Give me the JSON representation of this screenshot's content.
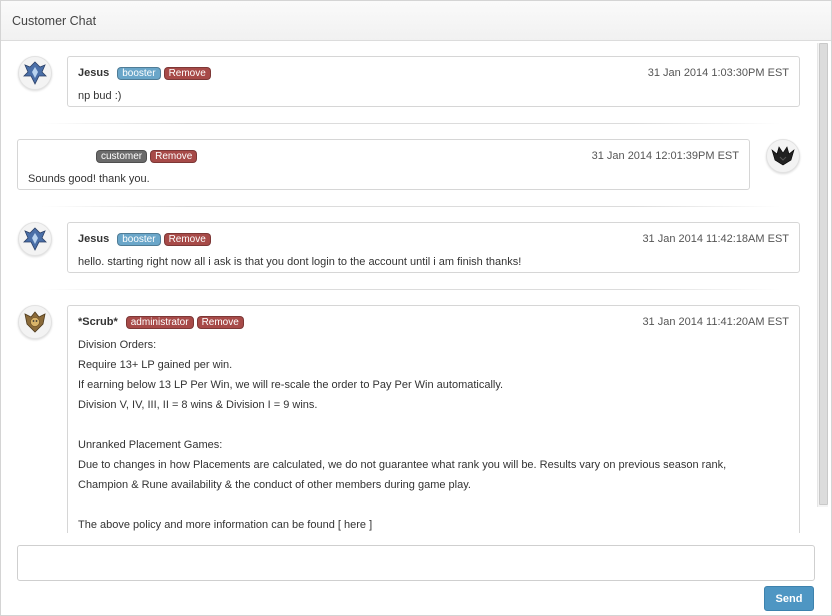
{
  "panel": {
    "title": "Customer Chat"
  },
  "messages": [
    {
      "name": "Jesus",
      "role": "booster",
      "remove_label": "Remove",
      "time": "31 Jan 2014 1:03:30PM EST",
      "text": "np bud :)",
      "avatar_icon": "diamond-rank-icon"
    },
    {
      "name": "",
      "role": "customer",
      "remove_label": "Remove",
      "time": "31 Jan 2014 12:01:39PM EST",
      "text": "Sounds good! thank you.",
      "avatar_icon": "dark-crest-icon"
    },
    {
      "name": "Jesus",
      "role": "booster",
      "remove_label": "Remove",
      "time": "31 Jan 2014 11:42:18AM EST",
      "text": "hello. starting right now all i ask is that you dont login to the account until i am finish thanks!",
      "avatar_icon": "diamond-rank-icon"
    },
    {
      "name": "*Scrub*",
      "role": "administrator",
      "remove_label": "Remove",
      "time": "31 Jan 2014 11:41:20AM EST",
      "avatar_icon": "gold-crest-icon",
      "lines": [
        "Division Orders:",
        "Require 13+ LP gained per win.",
        "If earning below 13 LP Per Win, we will re-scale the order to Pay Per Win automatically.",
        "Division V, IV, III, II = 8 wins & Division I = 9 wins.",
        "",
        "Unranked Placement Games:",
        "Due to changes in how Placements are calculated, we do not guarantee what rank you will be. Results vary on previous season rank,",
        "Champion & Rune availability & the conduct of other members during game play.",
        "",
        "The above policy and more information can be found [ here ]"
      ]
    }
  ],
  "composer": {
    "placeholder": "",
    "send_label": "Send"
  },
  "colors": {
    "booster": "#6aa6c9",
    "remove": "#a74a48",
    "customer": "#6a6a6a",
    "send": "#4e96c3"
  }
}
